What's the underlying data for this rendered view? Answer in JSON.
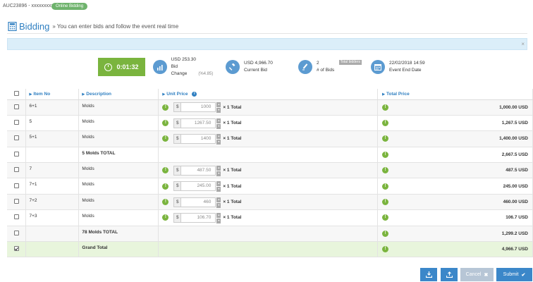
{
  "header": {
    "auction_id": "AUC23896 - xxxxxxxxxxx",
    "badge": "Online Bidding"
  },
  "title": {
    "main": "Bidding",
    "subtitle": "» You can enter bids and follow the event real time"
  },
  "info_bar": {
    "close": "×"
  },
  "timer": {
    "value": "0:01:32"
  },
  "stats": {
    "bid_change": {
      "value": "USD 253.30",
      "label": "Bid Change",
      "percent": "(%4.85)"
    },
    "current_bid": {
      "value": "USD 4,966.70",
      "label": "Current Bid"
    },
    "bids": {
      "value": "2",
      "label": "# of Bids",
      "tag": "Total bidders"
    },
    "end_date": {
      "value": "22/02/2018 14:59",
      "label": "Event End Date"
    }
  },
  "table": {
    "headers": {
      "item_no": "Item No",
      "description": "Description",
      "unit_price": "Unit Price",
      "total_price": "Total Price"
    },
    "currency_symbol": "$",
    "rows": [
      {
        "item": "6+1",
        "desc": "Molds",
        "price": "1000",
        "qty": "× 1 Total",
        "total": "1,000.00 USD"
      },
      {
        "item": "5",
        "desc": "Molds",
        "price": "1267.50",
        "qty": "× 1 Total",
        "total": "1,267.5 USD"
      },
      {
        "item": "5+1",
        "desc": "Molds",
        "price": "1400",
        "qty": "× 1 Total",
        "total": "1,400.00 USD"
      },
      {
        "item": "",
        "desc": "5 Molds TOTAL",
        "price": "",
        "qty": "",
        "total": "2,667.5 USD"
      },
      {
        "item": "7",
        "desc": "Molds",
        "price": "487.50",
        "qty": "× 1 Total",
        "total": "487.5 USD"
      },
      {
        "item": "7+1",
        "desc": "Molds",
        "price": "245.00",
        "qty": "× 1 Total",
        "total": "245.00 USD"
      },
      {
        "item": "7+2",
        "desc": "Molds",
        "price": "460",
        "qty": "× 1 Total",
        "total": "460.00 USD"
      },
      {
        "item": "7+3",
        "desc": "Molds",
        "price": "106.70",
        "qty": "× 1 Total",
        "total": "106.7 USD"
      },
      {
        "item": "",
        "desc": "78 Molds TOTAL",
        "price": "",
        "qty": "",
        "total": "1,299.2 USD"
      },
      {
        "item": "",
        "desc": "Grand Total",
        "price": "",
        "qty": "",
        "total": "4,966.7 USD"
      }
    ]
  },
  "buttons": {
    "cancel": "Cancel",
    "submit": "Submit"
  },
  "colors": {
    "accent": "#2f7fc1",
    "success": "#7ab43e",
    "primary_button": "#3b87c9"
  }
}
